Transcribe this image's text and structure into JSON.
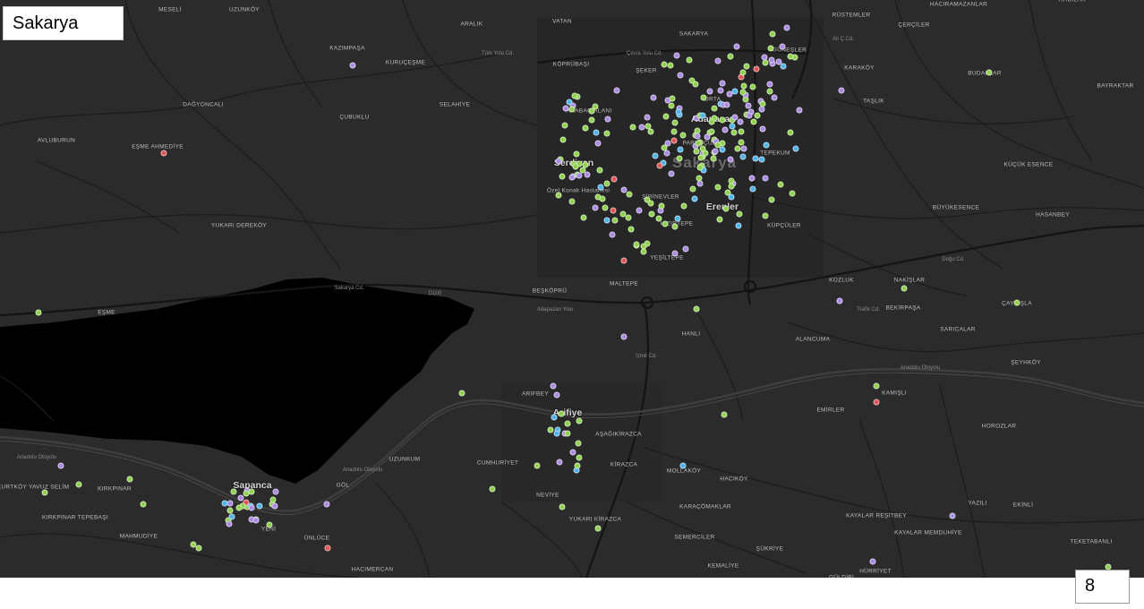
{
  "title": "Sakarya",
  "page_number": "8",
  "map": {
    "region_label": "Sakarya",
    "colors": {
      "background": "#2b2b2b",
      "lake": "#000000",
      "roads": "#1a1a1a",
      "highway": "#0f0f0f",
      "dot_green": "#8fd14f",
      "dot_purple": "#a98be0",
      "dot_blue": "#4fb3e8",
      "dot_red": "#e05555"
    },
    "cities": [
      "Adapazarı",
      "Serdivan",
      "Erenler",
      "Arifiye",
      "Sapanca"
    ],
    "places": [
      "MESELİ",
      "UZUNKÖY",
      "ARALIK",
      "VATAN",
      "SAKARYA",
      "RÜSTEMLER",
      "HACIRAMAZANLAR",
      "HACILAR",
      "GÜNEŞLER",
      "ÇERÇİLER",
      "KAZIMPAŞA",
      "KURUÇEŞME",
      "KÖPRÜBAŞI",
      "ŞEKER",
      "KARAKÖY",
      "BUDAKLAR",
      "BAYRAKTAR",
      "DAĞYONCALI",
      "SELAHİYE",
      "ÇUBUKLU",
      "ARABACIALANI",
      "ORTA",
      "TAŞLIK",
      "AVLUBURUN",
      "EŞME AHMEDİYE",
      "PAPUÇÇULAR",
      "TEPEKUM",
      "KÜÇÜK ESENCE",
      "Özel Konak Hastanesi",
      "ŞİRİNEVLER",
      "BÜYÜKESENCE",
      "HASANBEY",
      "YUKARI DEREKÖY",
      "HIZIRTEPE",
      "KÜPÇÜLER",
      "YEŞİLTEPE",
      "MALTEPE",
      "BEŞKÖPRÜ",
      "KOZLUK",
      "NAKİŞLAR",
      "BEKİRPAŞA",
      "ÇAYKIŞLA",
      "EŞME",
      "HANLI",
      "ALANCUMA",
      "SARICALAR",
      "ŞEYHKÖY",
      "ARİFBEY",
      "KAMIŞLI",
      "EMİRLER",
      "HOROZLAR",
      "AŞAĞIKİRAZCA",
      "CUMHURİYET",
      "UZUNKUM",
      "KİRAZCA",
      "MOLLAKÖY",
      "HACIKÖY",
      "KURTKÖY YAVUZ SELİM",
      "KIRKPINAR",
      "KIRKPINAR TEPEBAŞI",
      "NEVİYE",
      "KARAÇÖMAKLAR",
      "YAZILI",
      "EKİNLİ",
      "GÖL",
      "ŞÜKRİYE",
      "KAYALAR REŞİTBEY",
      "KAYALAR MEMDUHİYE",
      "MAHMUDİYE",
      "YENİ",
      "ÜNLÜCE",
      "YUKARI KİRAZCA",
      "SEMERCİLER",
      "TEKETABANLI",
      "HACIMERCAN",
      "KEMALİYE",
      "HÜRRİYET",
      "GÜLDİBİ"
    ],
    "road_labels": [
      "D100",
      "Anadolu Otoyolu",
      "Anadolu Otoyolu",
      "Anadolu Otoyolu",
      "Çevre Yolu Cd.",
      "Türk Yolu Cd.",
      "İzmit Cd.",
      "Ali Ç.Cd.",
      "Sakarya Cd.",
      "Doğu Cd.",
      "Adapazarı Yolu",
      "Trafik Cd."
    ]
  }
}
